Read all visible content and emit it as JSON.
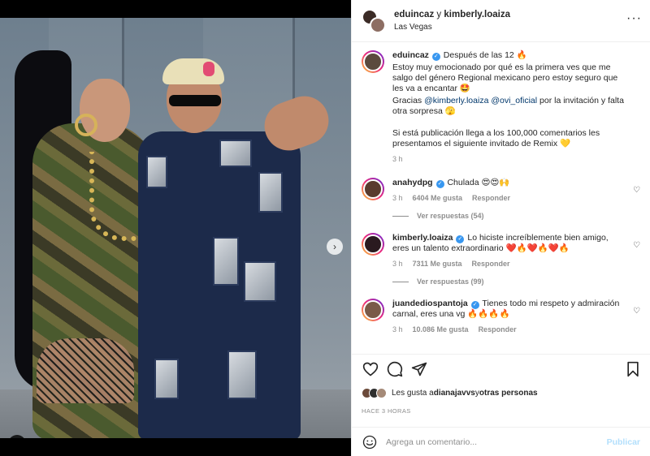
{
  "header": {
    "user1": "eduincaz",
    "separator": "y",
    "user2": "kimberly.loaiza",
    "location": "Las Vegas",
    "more_icon": "more-dots-icon"
  },
  "caption": {
    "user": "eduincaz",
    "first_line": "Después de las 12 🔥",
    "p1": "Estoy muy emocionado por qué es la primera ves que me salgo del género Regional mexicano pero estoy seguro que les va a encantar 🤩",
    "p2_prefix": "Gracias ",
    "p2_mention1": "@kimberly.loaiza",
    "p2_mention2": "@ovi_oficial",
    "p2_suffix": " por la invitación y falta otra sorpresa 🫣",
    "p3": "Si está publicación llega a los 100,000 comentarios les presentamos el siguiente invitado de Remix 💛",
    "time": "3 h"
  },
  "comments": [
    {
      "user": "anahydpg",
      "text": "Chulada 😍😍🙌",
      "time": "3 h",
      "likes": "6404 Me gusta",
      "reply": "Responder",
      "view_replies": "Ver respuestas (54)",
      "avatar_color": "#5a3b2e"
    },
    {
      "user": "kimberly.loaiza",
      "text": "Lo hiciste increíblemente bien amigo, eres un talento extraordinario ❤️🔥❤️🔥❤️🔥",
      "time": "3 h",
      "likes": "7311 Me gusta",
      "reply": "Responder",
      "view_replies": "Ver respuestas (99)",
      "avatar_color": "#2a1a1f"
    },
    {
      "user": "juandediospantoja",
      "text": "Tienes todo mi respeto y admiración carnal, eres una vg 🔥🔥🔥🔥",
      "time": "3 h",
      "likes": "10.086 Me gusta",
      "reply": "Responder",
      "view_replies": "",
      "avatar_color": "#7a5a48"
    }
  ],
  "likes": {
    "prefix": "Les gusta a ",
    "user": "dianajavvs",
    "middle": " y ",
    "others": "otras personas"
  },
  "time_ago": "HACE 3 HORAS",
  "add_comment": {
    "placeholder": "Agrega un comentario...",
    "publish": "Publicar"
  },
  "colors": {
    "link": "#00376b",
    "verified": "#3897f0",
    "publish_disabled": "#b2dffc",
    "secondary_text": "#8e8e8e"
  },
  "carousel": {
    "slides": 4,
    "active": 1
  }
}
